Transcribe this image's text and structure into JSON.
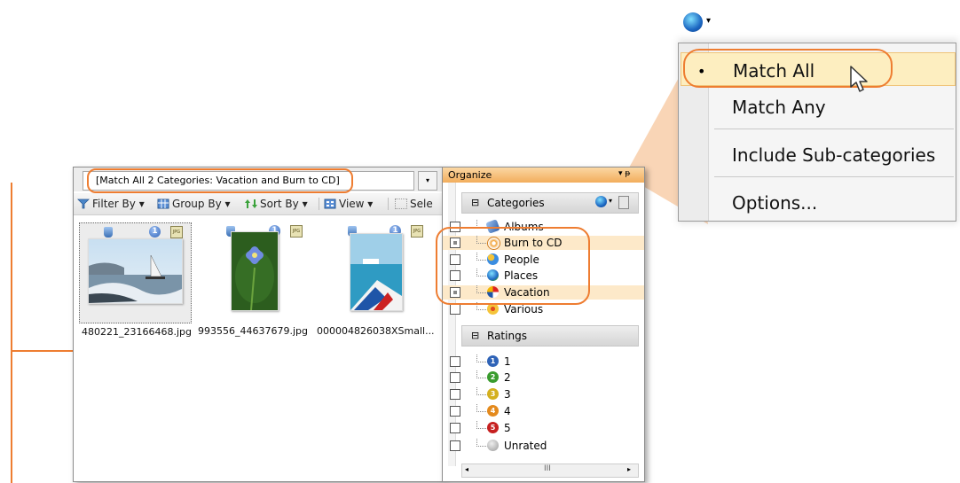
{
  "filter": {
    "text": "[Match All 2 Categories: Vacation and Burn to CD]",
    "drop": "▾"
  },
  "toolbar": {
    "filter_by": "Filter By",
    "group_by": "Group By",
    "sort_by": "Sort By",
    "view": "View",
    "select": "Sele"
  },
  "thumbnails": [
    {
      "name": "480221_23166468.jpg",
      "rating": "1",
      "badge": "JPG"
    },
    {
      "name": "993556_44637679.jpg",
      "rating": "1",
      "badge": "JPG"
    },
    {
      "name": "000004826038XSmall...",
      "rating": "1",
      "badge": "JPG"
    }
  ],
  "organize": {
    "title": "Organize",
    "controls": "▾ ᵽ",
    "categories_label": "Categories",
    "categories": [
      {
        "label": "Albums",
        "icon": "albums-icon",
        "highlight": false,
        "state": "unchecked"
      },
      {
        "label": "Burn to CD",
        "icon": "burn-icon",
        "highlight": true,
        "state": "mixed"
      },
      {
        "label": "People",
        "icon": "people-icon",
        "highlight": false,
        "state": "unchecked"
      },
      {
        "label": "Places",
        "icon": "places-icon",
        "highlight": false,
        "state": "unchecked"
      },
      {
        "label": "Vacation",
        "icon": "vacation-icon",
        "highlight": true,
        "state": "mixed"
      },
      {
        "label": "Various",
        "icon": "various-icon",
        "highlight": false,
        "state": "unchecked"
      }
    ],
    "ratings_label": "Ratings",
    "ratings": [
      {
        "label": "1",
        "badge": "1",
        "color": "#2f63b7"
      },
      {
        "label": "2",
        "badge": "2",
        "color": "#3a9c2e"
      },
      {
        "label": "3",
        "badge": "3",
        "color": "#d4b01f"
      },
      {
        "label": "4",
        "badge": "4",
        "color": "#e48a1d"
      },
      {
        "label": "5",
        "badge": "5",
        "color": "#c62020"
      },
      {
        "label": "Unrated",
        "badge": "",
        "color": "#b5b5b5"
      }
    ],
    "scroll_mark": "III"
  },
  "popup": {
    "bullet": "•",
    "match_all": "Match All",
    "match_any": "Match Any",
    "include_sub": "Include Sub-categories",
    "options": "Options..."
  },
  "colors": {
    "accent": "#ee7d31",
    "highlight": "#fde9c9"
  }
}
